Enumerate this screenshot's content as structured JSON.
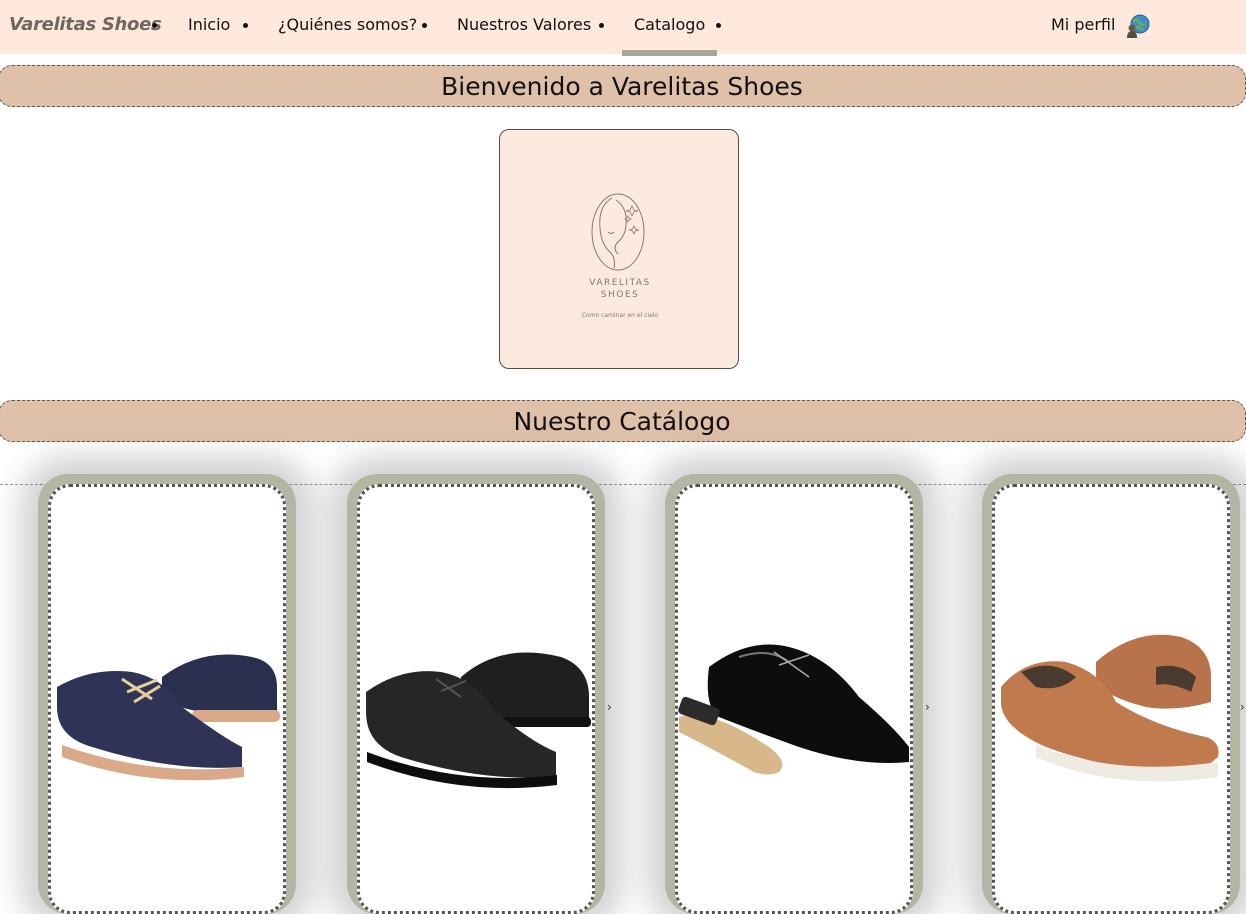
{
  "nav": {
    "brand": "Varelitas Shoes",
    "links": [
      "Inicio",
      "¿Quiénes somos?",
      "Nuestros Valores",
      "Catalogo"
    ],
    "active": "Catalogo",
    "profile_label": "Mi perfil",
    "profile_icon": "globe-user-icon"
  },
  "welcome": {
    "title": "Bienvenido a Varelitas Shoes"
  },
  "logo": {
    "name_line1": "VARELITAS",
    "name_line2": "SHOES",
    "tagline": "Como caminar en el cielo"
  },
  "catalog": {
    "title": "Nuestro Catálogo",
    "items": [
      {
        "name": "navy-oxford-shoe",
        "color": "#2b2f4f"
      },
      {
        "name": "black-oxford-shoe",
        "color": "#1a1a1a"
      },
      {
        "name": "patent-leather-shoe",
        "color": "#0d0d0d"
      },
      {
        "name": "tan-slip-on-shoe",
        "color": "#b8734a"
      }
    ],
    "next_icon": "chevron-right-icon",
    "next_label": "›"
  },
  "colors": {
    "nav_bg": "#fee9dc",
    "banner_bg": "#dfc0a8",
    "card_frame": "#b5b5a3",
    "active_underline": "#a8a898"
  }
}
